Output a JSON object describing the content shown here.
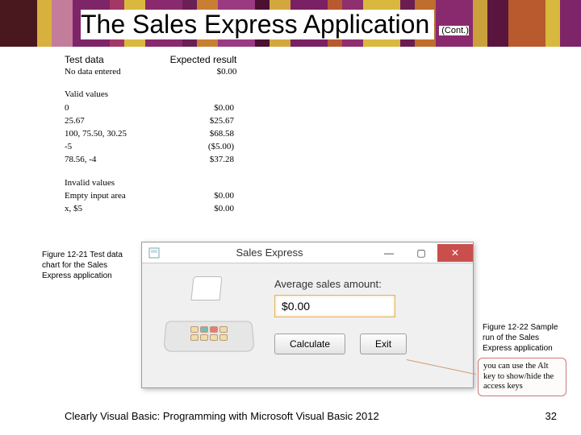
{
  "title": "The Sales Express Application",
  "cont": "(Cont.)",
  "test": {
    "hdr_data": "Test data",
    "hdr_result": "Expected result",
    "no_data_label": "No data entered",
    "no_data_val": "$0.00",
    "valid_hdr": "Valid values",
    "valid": [
      {
        "in": "0",
        "out": "$0.00"
      },
      {
        "in": "25.67",
        "out": "$25.67"
      },
      {
        "in": "100, 75.50, 30.25",
        "out": "$68.58"
      },
      {
        "in": "-5",
        "out": "($5.00)"
      },
      {
        "in": "78.56, -4",
        "out": "$37.28"
      }
    ],
    "invalid_hdr": "Invalid values",
    "invalid": [
      {
        "in": "Empty input area",
        "out": "$0.00"
      },
      {
        "in": "x, $5",
        "out": "$0.00"
      }
    ]
  },
  "fig_left": "Figure 12-21 Test data chart for the Sales Express application",
  "fig_right": "Figure 12-22 Sample run of the Sales Express application",
  "app": {
    "title": "Sales Express",
    "label": "Average sales amount:",
    "amount": "$0.00",
    "calc": "Calculate",
    "exit": "Exit"
  },
  "callout": "you can use the Alt key to show/hide the access keys",
  "footer_left": "Clearly Visual Basic: Programming with Microsoft Visual Basic 2012",
  "footer_right": "32",
  "stripes": [
    "#49181f",
    "#d8b03e",
    "#c37d9a",
    "#7e2569",
    "#a33866",
    "#d9b93d",
    "#8a2a6e",
    "#6a1f55",
    "#c97f33",
    "#993a83",
    "#4c1032",
    "#d4a73d",
    "#7a2065",
    "#b85a2d",
    "#8e2f6e",
    "#d9b93d",
    "#6b1d52",
    "#bf6e2e",
    "#8a2a6e",
    "#caa03a",
    "#5a153f",
    "#b85a2d",
    "#d9b93d",
    "#7e2569"
  ]
}
